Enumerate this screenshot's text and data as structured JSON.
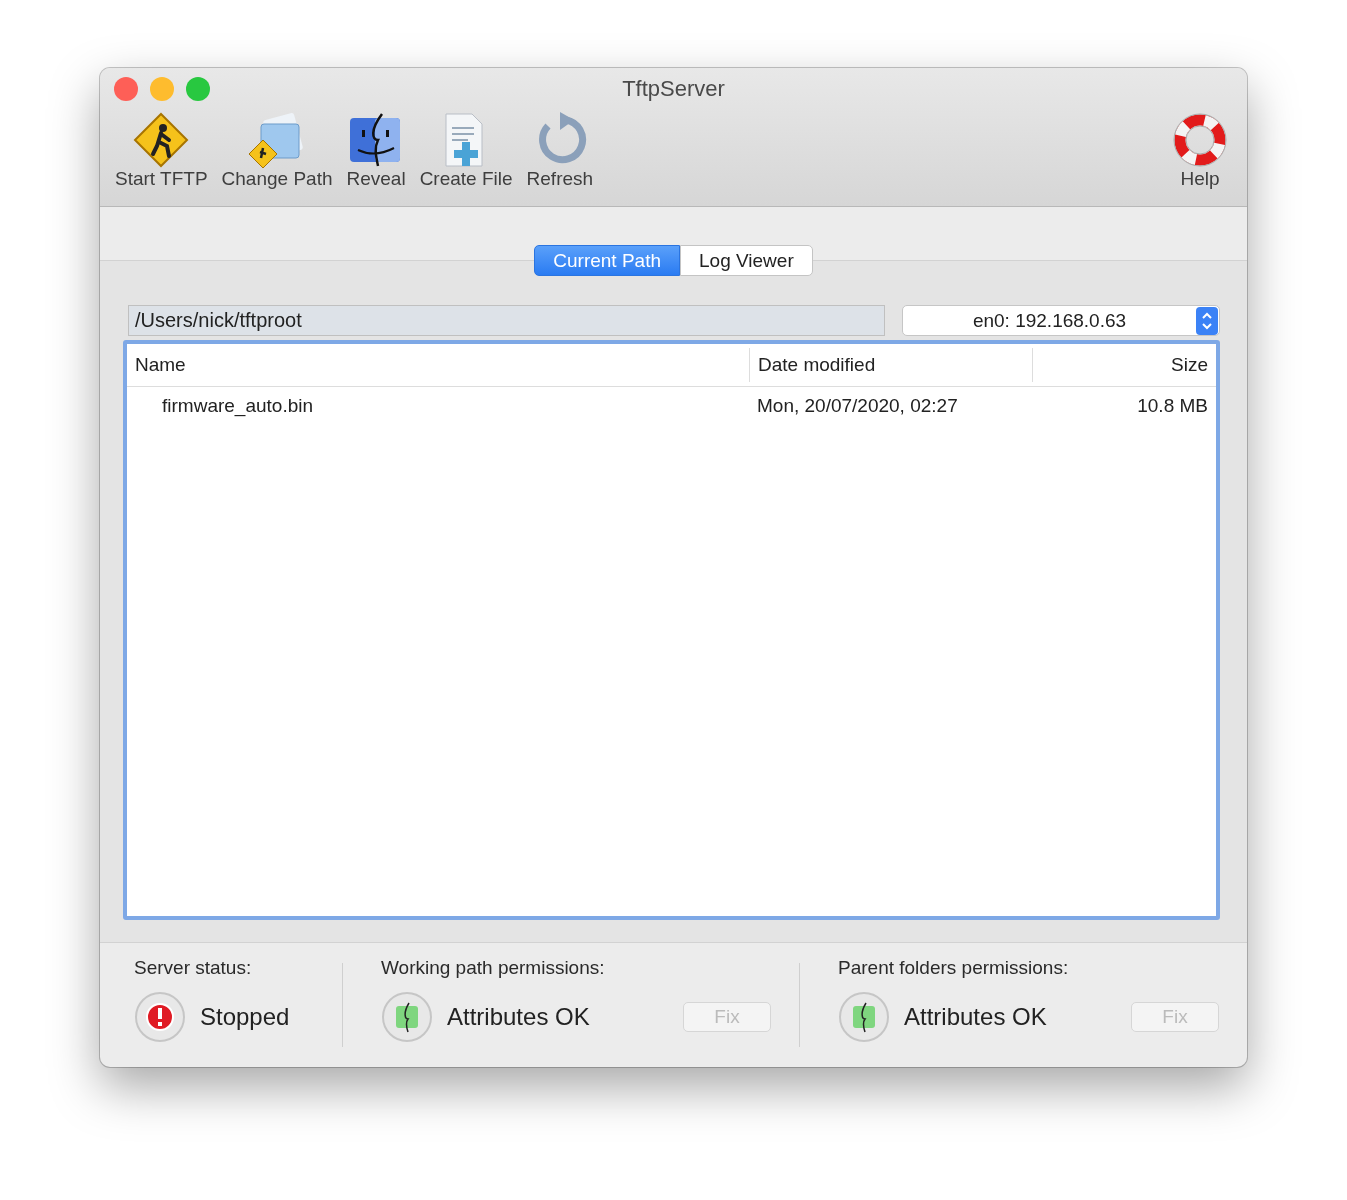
{
  "window": {
    "title": "TftpServer"
  },
  "toolbar": [
    {
      "label": "Start TFTP",
      "kind": "sign"
    },
    {
      "label": "Change Path",
      "kind": "folder"
    },
    {
      "label": "Reveal",
      "kind": "finder"
    },
    {
      "label": "Create File",
      "kind": "newfile"
    },
    {
      "label": "Refresh",
      "kind": "refresh"
    }
  ],
  "help": {
    "label": "Help"
  },
  "tabs": [
    {
      "label": "Current Path",
      "selected": true
    },
    {
      "label": "Log Viewer",
      "selected": false
    }
  ],
  "path_field": {
    "value": "/Users/nick/tftproot"
  },
  "interface_popup": {
    "value": "en0: 192.168.0.63"
  },
  "table": {
    "columns": [
      "Name",
      "Date modified",
      "Size"
    ],
    "rows": [
      [
        "firmware_auto.bin",
        "Mon, 20/07/2020, 02:27",
        "10.8 MB"
      ]
    ]
  },
  "status": [
    {
      "title": "Server status:",
      "kind": "error",
      "text": "Stopped"
    },
    {
      "title": "Working path permissions:",
      "kind": "ok",
      "text": "Attributes OK",
      "fix": {
        "label": "Fix",
        "disabled": true
      }
    },
    {
      "title": "Parent folders permissions:",
      "kind": "ok",
      "text": "Attributes OK",
      "fix": {
        "label": "Fix",
        "disabled": true
      }
    }
  ]
}
